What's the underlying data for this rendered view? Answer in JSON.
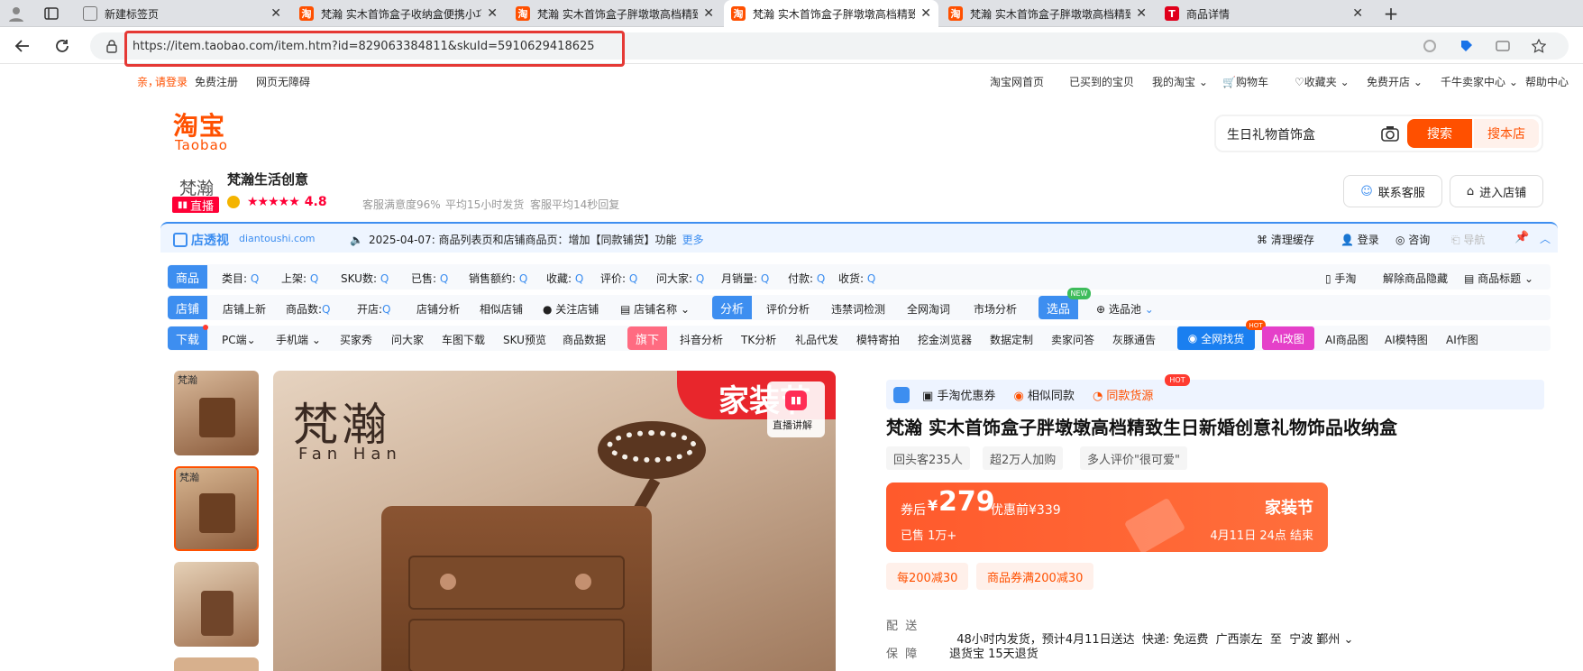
{
  "browser": {
    "tabs": [
      {
        "title": "新建标签页",
        "color": "#888888",
        "glyph": ""
      },
      {
        "title": "梵瀚 实木首饰盒子收纳盒便携小巧",
        "color": "#ff5000",
        "glyph": "淘"
      },
      {
        "title": "梵瀚 实木首饰盒子胖墩墩高档精致",
        "color": "#ff5000",
        "glyph": "淘"
      },
      {
        "title": "梵瀚 实木首饰盒子胖墩墩高档精致",
        "color": "#ff5000",
        "glyph": "淘"
      },
      {
        "title": "梵瀚 实木首饰盒子胖墩墩高档精致",
        "color": "#ff5000",
        "glyph": "淘"
      },
      {
        "title": "商品详情",
        "color": "#e0001b",
        "glyph": "T"
      }
    ],
    "url": "https://item.taobao.com/item.htm?id=829063384811&skuId=5910629418625"
  },
  "topnav": {
    "greeting": "亲，",
    "login": "请登录",
    "register": "免费注册",
    "accessible": "网页无障碍",
    "right": [
      "淘宝网首页",
      "已买到的宝贝",
      "我的淘宝",
      "购物车",
      "收藏夹",
      "免费开店",
      "千牛卖家中心",
      "帮助中心"
    ]
  },
  "logo": {
    "main": "淘宝",
    "sub": "Taobao"
  },
  "search": {
    "value": "生日礼物首饰盒",
    "search_btn": "搜索",
    "shop_btn": "搜本店"
  },
  "shop": {
    "avatar_text": "梵瀚",
    "live_badge": "直播",
    "name": "梵瀚生活创意",
    "rating": "4.8",
    "stats": [
      "客服满意度96%",
      "平均15小时发货",
      "客服平均14秒回复"
    ],
    "contact": "联系客服",
    "enter": "进入店铺"
  },
  "plugin": {
    "brand": "店透视",
    "domain": "diantoushi.com",
    "notice": "2025-04-07: 商品列表页和店铺商品页：增加【同款铺货】功能",
    "more": "更多",
    "actions": [
      "清理缓存",
      "登录",
      "咨询",
      "导航"
    ],
    "row1_label": "商品",
    "row1": [
      "类目:",
      "上架:",
      "SKU数:",
      "已售:",
      "销售额约:",
      "收藏:",
      "评价:",
      "问大家:",
      "月销量:",
      "付款:",
      "收货:"
    ],
    "row1_right": [
      "手淘",
      "解除商品隐藏",
      "商品标题"
    ],
    "row2_label": "店铺",
    "row2": [
      "店铺上新",
      "商品数:",
      "开店:",
      "店铺分析",
      "相似店铺",
      "关注店铺",
      "店铺名称"
    ],
    "row2_label_b": "分析",
    "row2_b": [
      "评价分析",
      "违禁词检测",
      "全网淘词",
      "市场分析"
    ],
    "row2_label_c": "选品",
    "new_badge": "NEW",
    "pool": "选品池",
    "row3_label": "下载",
    "row3": [
      "PC端",
      "手机端",
      "买家秀",
      "问大家",
      "车图下载",
      "SKU预览",
      "商品数据"
    ],
    "row3_label_b": "旗下",
    "row3_b": [
      "抖音分析",
      "TK分析",
      "礼品代发",
      "模特寄拍",
      "挖金浏览器",
      "数据定制",
      "卖家问答",
      "灰豚通告"
    ],
    "find_btn": "全网找货",
    "hot": "HOT",
    "ai_btn": "AI改图",
    "ai_items": [
      "AI商品图",
      "AI模特图",
      "AI作图"
    ]
  },
  "product": {
    "image_brand_cn": "梵瀚",
    "image_brand_en": "Fan Han",
    "image_banner": "家装节",
    "live_label": "直播讲解",
    "thumb_text": "梵瀚",
    "strip": [
      "手淘优惠券",
      "相似同款",
      "同款货源"
    ],
    "strip_hot": "HOT",
    "title": "梵瀚 实木首饰盒子胖墩墩高档精致生日新婚创意礼物饰品收纳盒",
    "chips": [
      "回头客235人",
      "超2万人加购",
      "多人评价\"很可爱\""
    ],
    "price_prefix": "券后",
    "currency": "¥",
    "price": "279",
    "orig_price": "优惠前¥339",
    "sold": "已售 1万+",
    "promo_name": "家装节",
    "promo_time": "4月11日 24点 结束",
    "coupons": [
      "每200减30",
      "商品券满200减30"
    ],
    "ship_label": "配  送",
    "ship_text": "48小时内发货，预计4月11日送达  快递: 免运费  广西崇左  至  宁波 鄞州",
    "guarantee_label": "保  障",
    "guarantee_text": "退货宝 15天退货"
  }
}
